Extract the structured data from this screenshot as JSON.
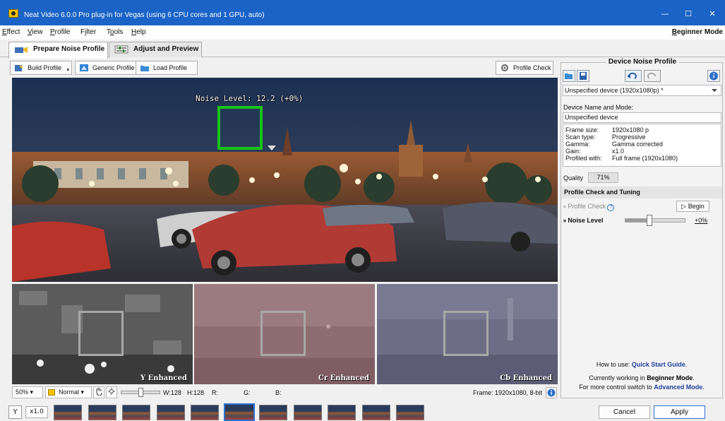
{
  "window": {
    "title": "Neat Video 6.0.0 Pro plug-in for Vegas (using 6 CPU cores and 1 GPU, auto)",
    "min_glyph": "—",
    "max_glyph": "☐",
    "close_glyph": "✕"
  },
  "menu": {
    "items": [
      {
        "u": "E",
        "rest": "ffect"
      },
      {
        "u": "V",
        "rest": "iew"
      },
      {
        "u": "P",
        "rest": "rofile"
      },
      {
        "u": "i",
        "pre": "F",
        "rest": "lter"
      },
      {
        "u": "o",
        "pre": "T",
        "rest": "ols"
      },
      {
        "u": "H",
        "rest": "elp"
      }
    ],
    "mode_u": "B",
    "mode_rest": "eginner Mode"
  },
  "tabs": {
    "prepare": "Prepare Noise Profile",
    "adjust": "Adjust and Preview"
  },
  "toolbar": {
    "build_profile": "Build Profile",
    "generic_profile": "Generic Profile",
    "load_profile": "Load Profile",
    "profile_check": "Profile Check"
  },
  "viewer": {
    "noise_level_label": "Noise Level: 12.2 (+0%)",
    "y_label": "Y Enhanced",
    "cr_label": "Cr Enhanced",
    "cb_label": "Cb Enhanced"
  },
  "statusbar": {
    "zoom": "50%",
    "blend_mode": "Normal",
    "w": "W:128",
    "h": "H:128",
    "r": "R:",
    "g": "G:",
    "b": "B:",
    "frame": "Frame: 1920x1080, 8-bit"
  },
  "filmstrip": {
    "y_button": "Y",
    "speed": "x1.0",
    "thumb_count": 11,
    "selected_index": 5
  },
  "panel": {
    "title": "Device Noise Profile",
    "device_select": "Unspecified device (1920x1080p) *",
    "name_label": "Device Name and Mode:",
    "name_value": "Unspecified device",
    "props": [
      {
        "k": "Frame size:",
        "v": "1920x1080 p"
      },
      {
        "k": "Scan type:",
        "v": "Progressive"
      },
      {
        "k": "Gamma:",
        "v": "Gamma corrected"
      },
      {
        "k": "Gain:",
        "v": "x1.0"
      },
      {
        "k": "Profiled with:",
        "v": "Full frame (1920x1080)"
      }
    ],
    "quality_label": "Quality",
    "quality_value": "71%",
    "tuning_title": "Profile Check and Tuning",
    "profile_check_label": "Profile Check",
    "help_icon_glyph": "?",
    "begin_button": "Begin",
    "noise_level_label": "Noise Level",
    "noise_level_value": "+0%",
    "noise_slider_fraction": 0.4,
    "help_line1_prefix": "How to use: ",
    "help_line1_link": "Quick Start Guide",
    "help_line1_suffix": ".",
    "help_line2_prefix": "Currently working in ",
    "help_line2_bold": "Beginner Mode",
    "help_line2_suffix": ".",
    "help_line3_prefix": "For more control switch to ",
    "help_line3_link": "Advanced Mode",
    "help_line3_suffix": "."
  },
  "buttons": {
    "cancel": "Cancel",
    "apply": "Apply"
  },
  "colors": {
    "titlebar": "#1b63c6",
    "measure_box": "#18c31b",
    "link": "#1f3f9a",
    "default_button_border": "#2e70d0"
  }
}
